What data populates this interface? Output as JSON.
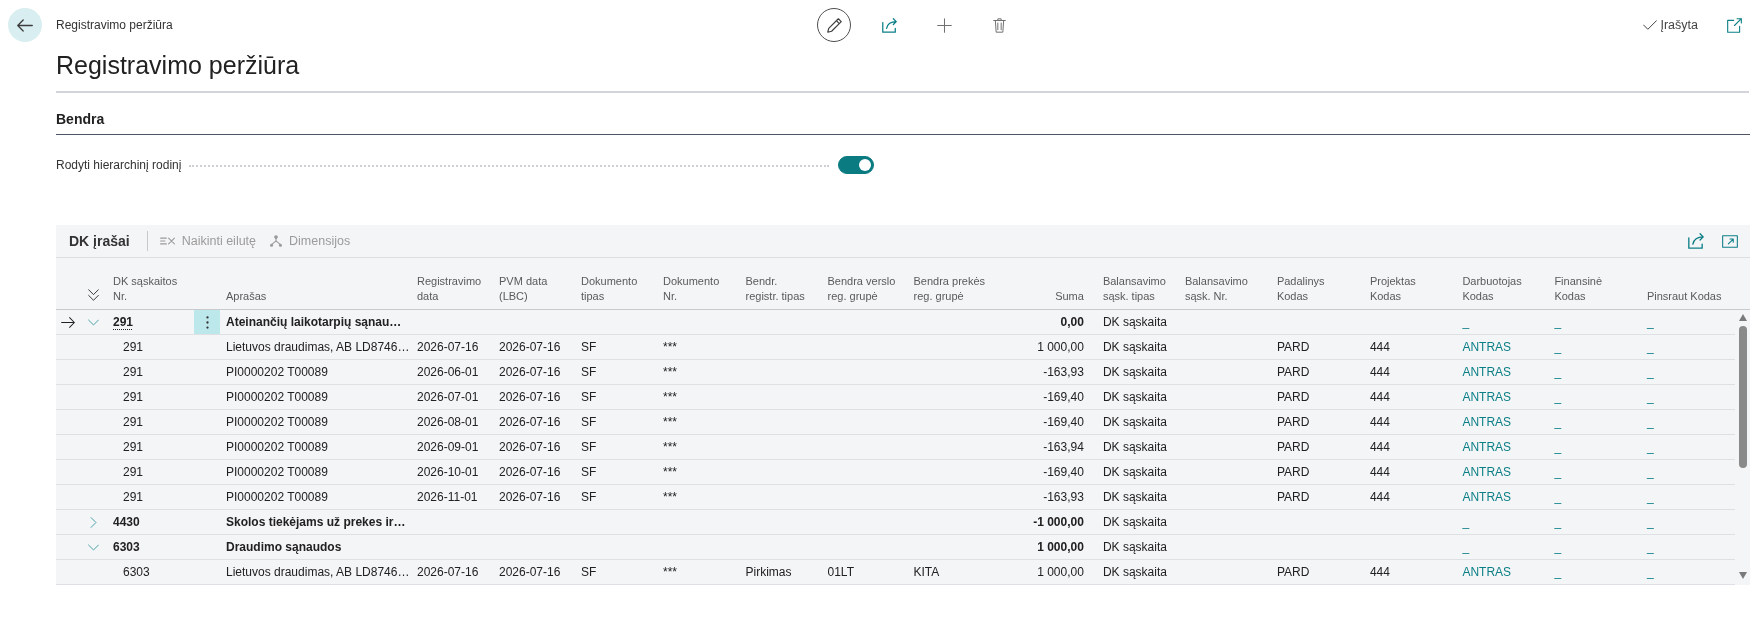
{
  "page": {
    "breadcrumb": "Registravimo peržiūra",
    "title": "Registravimo peržiūra",
    "status": "Įrašyta"
  },
  "section": {
    "title": "Bendra",
    "field": {
      "label": "Rodyti hierarchinį rodinį",
      "on": true
    }
  },
  "lines": {
    "title": "DK įrašai",
    "actions": [
      {
        "label": "Naikinti eilutę",
        "disabled": true
      },
      {
        "label": "Dimensijos",
        "disabled": true
      }
    ],
    "columns": [
      "DK sąskaitos Nr.",
      "Aprašas",
      "Registravimo data",
      "PVM data (LBC)",
      "Dokumento tipas",
      "Dokumento Nr.",
      "Bendr. registr. tipas",
      "Bendra verslo reg. grupė",
      "Bendra prekės reg. grupė",
      "Suma",
      "Balansavimo sąsk. tipas",
      "Balansavimo sąsk. Nr.",
      "Padalinys Kodas",
      "Projektas Kodas",
      "Darbuotojas Kodas",
      "Finansinė Kodas",
      "Pinsraut Kodas"
    ],
    "rows": [
      {
        "selected": true,
        "expanded": true,
        "cells": {
          "account": "291",
          "description": "Ateinančių laikotarpių sąnau…",
          "amount": "0,00",
          "bal_account_type": "DK sąskaita",
          "employee_code": "_",
          "financial_code": "_",
          "pinsraut_code": "_"
        },
        "children": [
          {
            "selected": false,
            "cells": {
              "account": "291",
              "description": "Lietuvos draudimas, AB LD8746…",
              "posting_date": "2026-07-16",
              "vat_date": "2026-07-16",
              "document_type": "SF",
              "document_no": "***",
              "amount": "1 000,00",
              "bal_account_type": "DK sąskaita",
              "department_code": "PARD",
              "project_code": "444",
              "employee_code": "ANTRAS",
              "financial_code": "_",
              "pinsraut_code": "_"
            }
          },
          {
            "selected": false,
            "cells": {
              "account": "291",
              "description": "PI0000202 T00089",
              "posting_date": "2026-06-01",
              "vat_date": "2026-07-16",
              "document_type": "SF",
              "document_no": "***",
              "amount": "-163,93",
              "bal_account_type": "DK sąskaita",
              "department_code": "PARD",
              "project_code": "444",
              "employee_code": "ANTRAS",
              "financial_code": "_",
              "pinsraut_code": "_"
            }
          },
          {
            "selected": false,
            "cells": {
              "account": "291",
              "description": "PI0000202 T00089",
              "posting_date": "2026-07-01",
              "vat_date": "2026-07-16",
              "document_type": "SF",
              "document_no": "***",
              "amount": "-169,40",
              "bal_account_type": "DK sąskaita",
              "department_code": "PARD",
              "project_code": "444",
              "employee_code": "ANTRAS",
              "financial_code": "_",
              "pinsraut_code": "_"
            }
          },
          {
            "selected": false,
            "cells": {
              "account": "291",
              "description": "PI0000202 T00089",
              "posting_date": "2026-08-01",
              "vat_date": "2026-07-16",
              "document_type": "SF",
              "document_no": "***",
              "amount": "-169,40",
              "bal_account_type": "DK sąskaita",
              "department_code": "PARD",
              "project_code": "444",
              "employee_code": "ANTRAS",
              "financial_code": "_",
              "pinsraut_code": "_"
            }
          },
          {
            "selected": false,
            "cells": {
              "account": "291",
              "description": "PI0000202 T00089",
              "posting_date": "2026-09-01",
              "vat_date": "2026-07-16",
              "document_type": "SF",
              "document_no": "***",
              "amount": "-163,94",
              "bal_account_type": "DK sąskaita",
              "department_code": "PARD",
              "project_code": "444",
              "employee_code": "ANTRAS",
              "financial_code": "_",
              "pinsraut_code": "_"
            }
          },
          {
            "selected": false,
            "cells": {
              "account": "291",
              "description": "PI0000202 T00089",
              "posting_date": "2026-10-01",
              "vat_date": "2026-07-16",
              "document_type": "SF",
              "document_no": "***",
              "amount": "-169,40",
              "bal_account_type": "DK sąskaita",
              "department_code": "PARD",
              "project_code": "444",
              "employee_code": "ANTRAS",
              "financial_code": "_",
              "pinsraut_code": "_"
            }
          },
          {
            "selected": false,
            "cells": {
              "account": "291",
              "description": "PI0000202 T00089",
              "posting_date": "2026-11-01",
              "vat_date": "2026-07-16",
              "document_type": "SF",
              "document_no": "***",
              "amount": "-163,93",
              "bal_account_type": "DK sąskaita",
              "department_code": "PARD",
              "project_code": "444",
              "employee_code": "ANTRAS",
              "financial_code": "_",
              "pinsraut_code": "_"
            }
          }
        ]
      },
      {
        "selected": false,
        "expanded": false,
        "cells": {
          "account": "4430",
          "description": "Skolos tiekėjams už prekes ir…",
          "amount": "-1 000,00",
          "bal_account_type": "DK sąskaita",
          "employee_code": "_",
          "financial_code": "_",
          "pinsraut_code": "_"
        }
      },
      {
        "selected": false,
        "expanded": true,
        "cells": {
          "account": "6303",
          "description": "Draudimo sąnaudos",
          "amount": "1 000,00",
          "bal_account_type": "DK sąskaita",
          "employee_code": "_",
          "financial_code": "_",
          "pinsraut_code": "_"
        },
        "children": [
          {
            "selected": false,
            "cells": {
              "account": "6303",
              "description": "Lietuvos draudimas, AB LD8746…",
              "posting_date": "2026-07-16",
              "vat_date": "2026-07-16",
              "document_type": "SF",
              "document_no": "***",
              "gen_posting_type": "Pirkimas",
              "gen_bus_group": "01LT",
              "gen_prod_group": "KITA",
              "amount": "1 000,00",
              "bal_account_type": "DK sąskaita",
              "department_code": "PARD",
              "project_code": "444",
              "employee_code": "ANTRAS",
              "financial_code": "_",
              "pinsraut_code": "_"
            }
          }
        ]
      }
    ]
  }
}
